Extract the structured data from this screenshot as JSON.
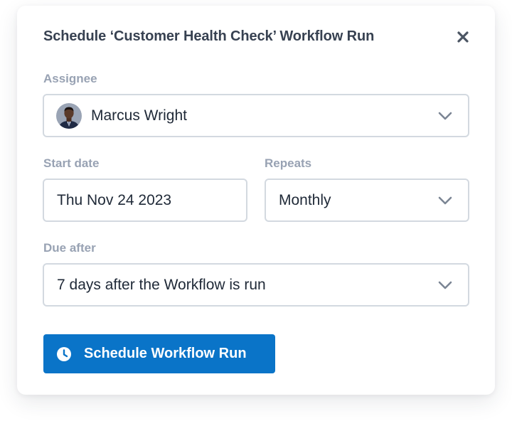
{
  "dialog": {
    "title": "Schedule ‘Customer Health Check’ Workflow Run",
    "close_icon": "close-icon"
  },
  "assignee": {
    "label": "Assignee",
    "value": "Marcus Wright",
    "avatar_icon": "avatar"
  },
  "start_date": {
    "label": "Start date",
    "value": "Thu Nov 24 2023"
  },
  "repeats": {
    "label": "Repeats",
    "value": "Monthly"
  },
  "due_after": {
    "label": "Due after",
    "value": "7 days after the Workflow is run"
  },
  "schedule_button": {
    "label": "Schedule Workflow Run",
    "icon": "clock-icon"
  },
  "colors": {
    "primary": "#0a74c8",
    "title_text": "#374151",
    "label_text": "#98a2b3",
    "field_border": "#d3d9e0"
  }
}
